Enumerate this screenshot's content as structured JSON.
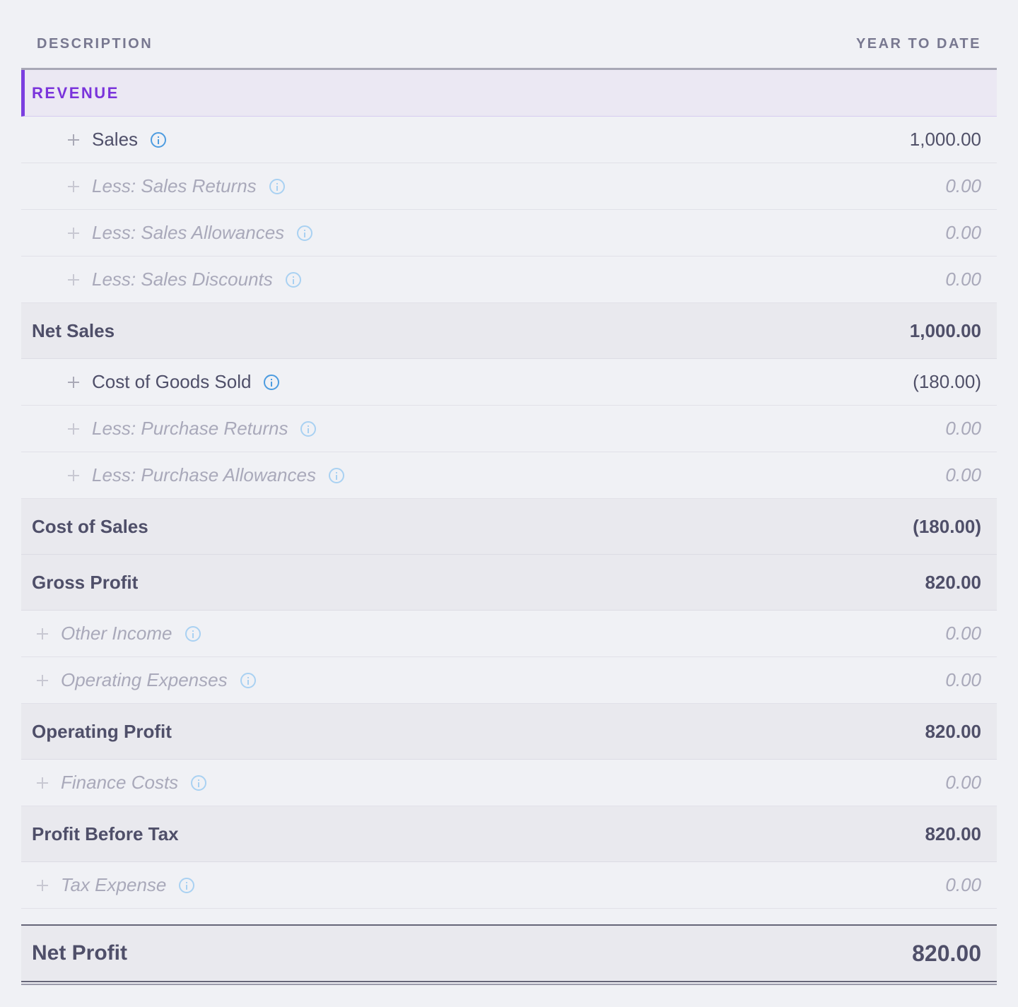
{
  "header": {
    "description": "DESCRIPTION",
    "year_to_date": "YEAR TO DATE"
  },
  "section": {
    "title": "REVENUE"
  },
  "rows": {
    "sales": {
      "label": "Sales",
      "value": "1,000.00"
    },
    "sales_returns": {
      "label": "Less: Sales Returns",
      "value": "0.00"
    },
    "sales_allowances": {
      "label": "Less: Sales Allowances",
      "value": "0.00"
    },
    "sales_discounts": {
      "label": "Less: Sales Discounts",
      "value": "0.00"
    },
    "net_sales": {
      "label": "Net Sales",
      "value": "1,000.00"
    },
    "cogs": {
      "label": "Cost of Goods Sold",
      "value": "(180.00)"
    },
    "purchase_returns": {
      "label": "Less: Purchase Returns",
      "value": "0.00"
    },
    "purchase_allowances": {
      "label": "Less: Purchase Allowances",
      "value": "0.00"
    },
    "cost_of_sales": {
      "label": "Cost of Sales",
      "value": "(180.00)"
    },
    "gross_profit": {
      "label": "Gross Profit",
      "value": "820.00"
    },
    "other_income": {
      "label": "Other Income",
      "value": "0.00"
    },
    "operating_expenses": {
      "label": "Operating Expenses",
      "value": "0.00"
    },
    "operating_profit": {
      "label": "Operating Profit",
      "value": "820.00"
    },
    "finance_costs": {
      "label": "Finance Costs",
      "value": "0.00"
    },
    "profit_before_tax": {
      "label": "Profit Before Tax",
      "value": "820.00"
    },
    "tax_expense": {
      "label": "Tax Expense",
      "value": "0.00"
    },
    "net_profit": {
      "label": "Net Profit",
      "value": "820.00"
    }
  },
  "icons": {
    "expand": "plus-icon",
    "info": "info-icon"
  },
  "colors": {
    "accent": "#7a34db",
    "info": "#4d9ce0",
    "background": "#f0f1f5"
  }
}
